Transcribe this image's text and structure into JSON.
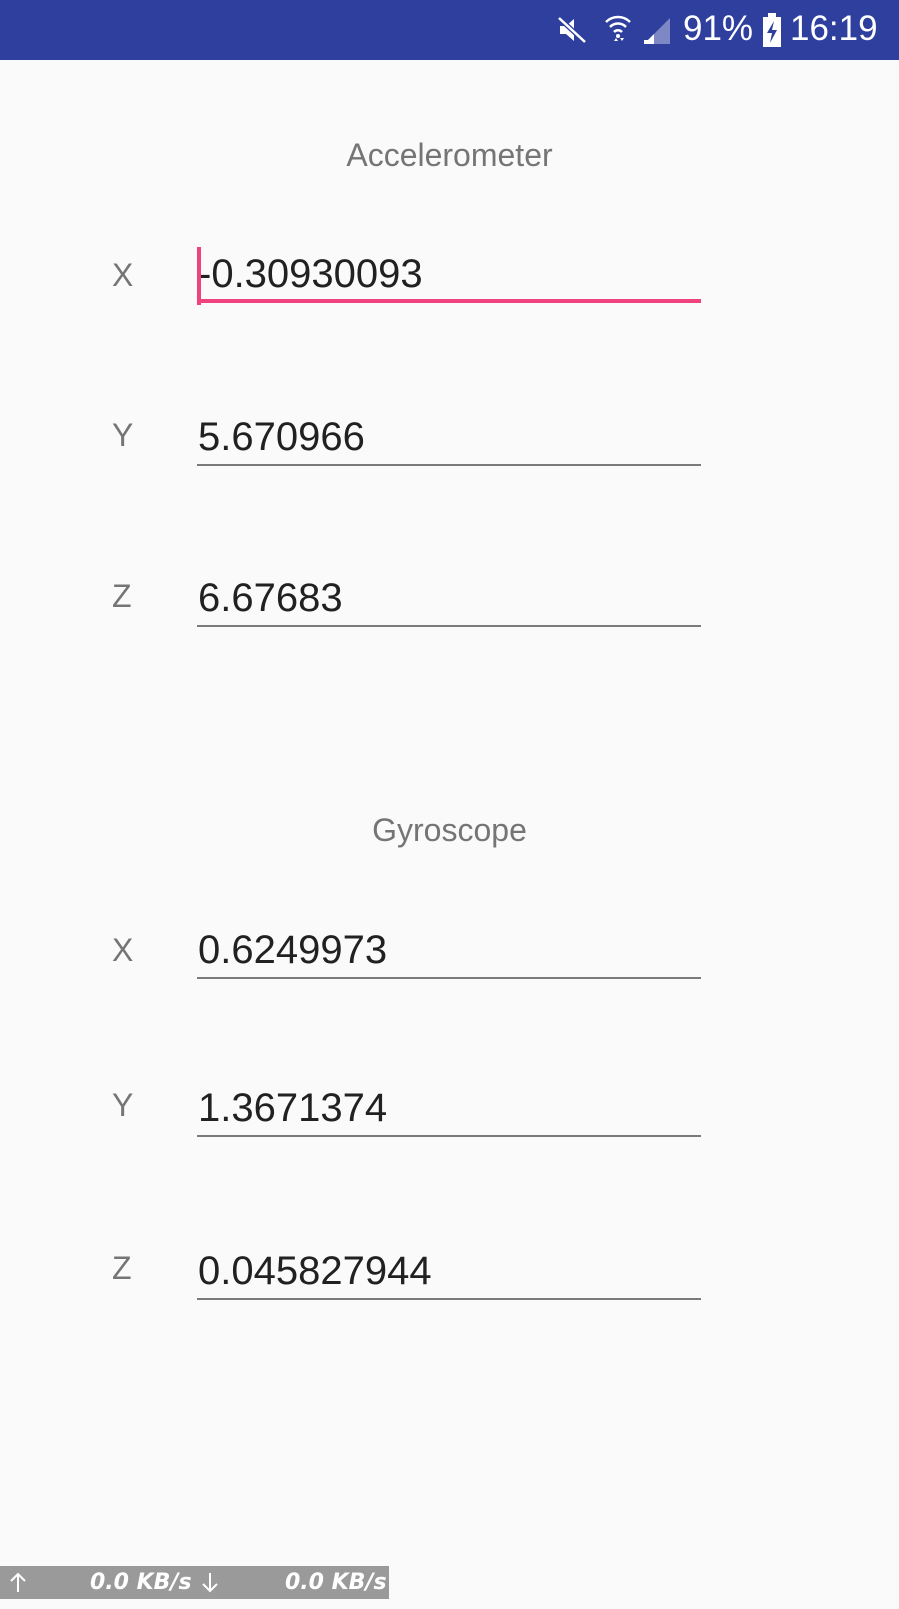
{
  "status_bar": {
    "battery_percent": "91%",
    "time": "16:19",
    "icons": [
      "mute-icon",
      "wifi-icon",
      "signal-icon",
      "battery-charging-icon"
    ]
  },
  "accelerometer": {
    "title": "Accelerometer",
    "x_label": "X",
    "x_value": "-0.30930093",
    "y_label": "Y",
    "y_value": "5.670966",
    "z_label": "Z",
    "z_value": "6.67683"
  },
  "gyroscope": {
    "title": "Gyroscope",
    "x_label": "X",
    "x_value": "0.6249973",
    "y_label": "Y",
    "y_value": "1.3671374",
    "z_label": "Z",
    "z_value": "0.045827944"
  },
  "network": {
    "upload": "0.0 KB/s",
    "download": "0.0 KB/s",
    "upload_icon": "arrow-up-icon",
    "download_icon": "arrow-down-icon"
  },
  "colors": {
    "status_bar": "#2e3f9d",
    "accent": "#f0427f",
    "background": "#fafafa"
  }
}
